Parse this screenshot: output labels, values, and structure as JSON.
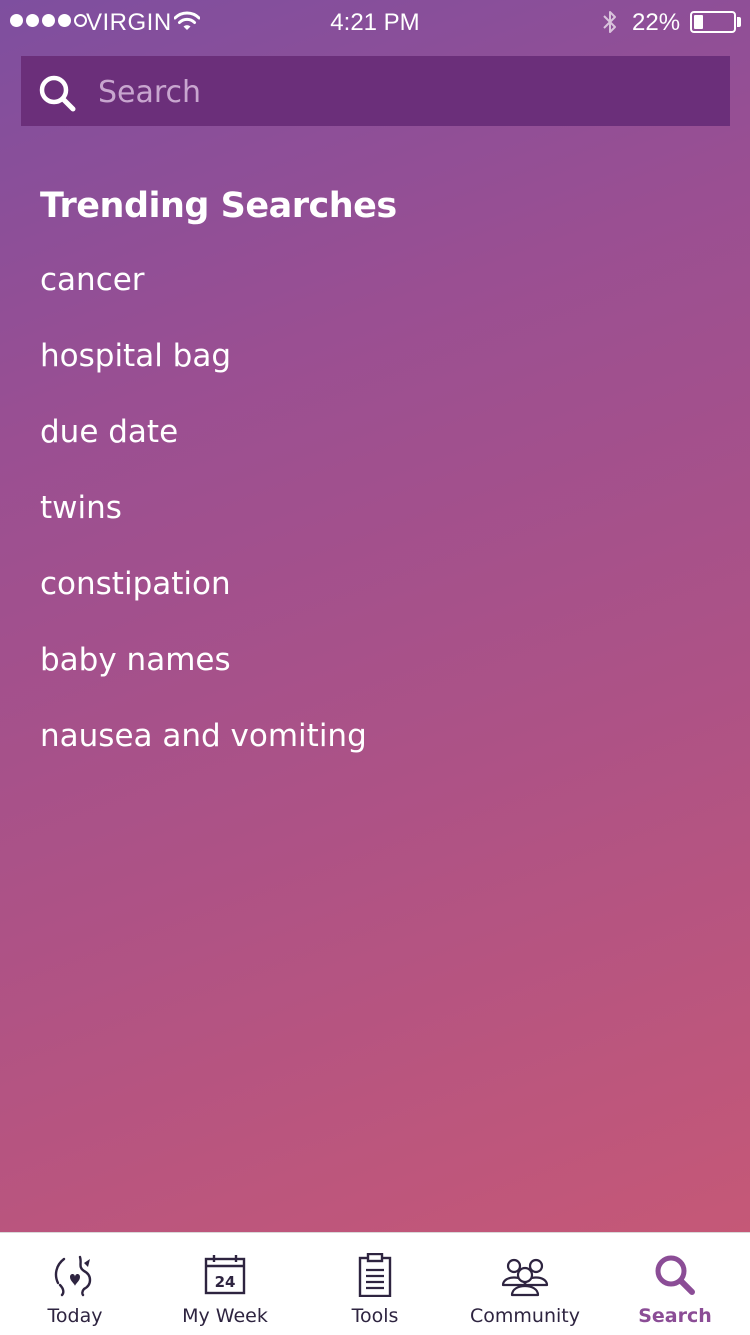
{
  "status_bar": {
    "signal_bars_filled": 4,
    "signal_bars_total": 5,
    "carrier": "VIRGIN",
    "time": "4:21 PM",
    "battery_percent_label": "22%",
    "battery_level": 0.22
  },
  "search": {
    "placeholder": "Search",
    "value": ""
  },
  "trending": {
    "title": "Trending Searches",
    "items": [
      "cancer",
      "hospital bag",
      "due date",
      "twins",
      "constipation",
      "baby names",
      "nausea and vomiting"
    ]
  },
  "tab_bar": {
    "tabs": [
      {
        "label": "Today",
        "icon": "pregnancy-icon",
        "active": false
      },
      {
        "label": "My Week",
        "icon": "calendar-icon",
        "calendar_number": "24",
        "active": false
      },
      {
        "label": "Tools",
        "icon": "clipboard-icon",
        "active": false
      },
      {
        "label": "Community",
        "icon": "people-icon",
        "active": false
      },
      {
        "label": "Search",
        "icon": "search-icon",
        "active": true
      }
    ]
  },
  "colors": {
    "tab_icon": "#2e2440",
    "tab_active": "#8b4d96",
    "search_bar_bg": "#6b2f7a",
    "gradient_top": "#7e4f9f",
    "gradient_bottom": "#c55877"
  }
}
